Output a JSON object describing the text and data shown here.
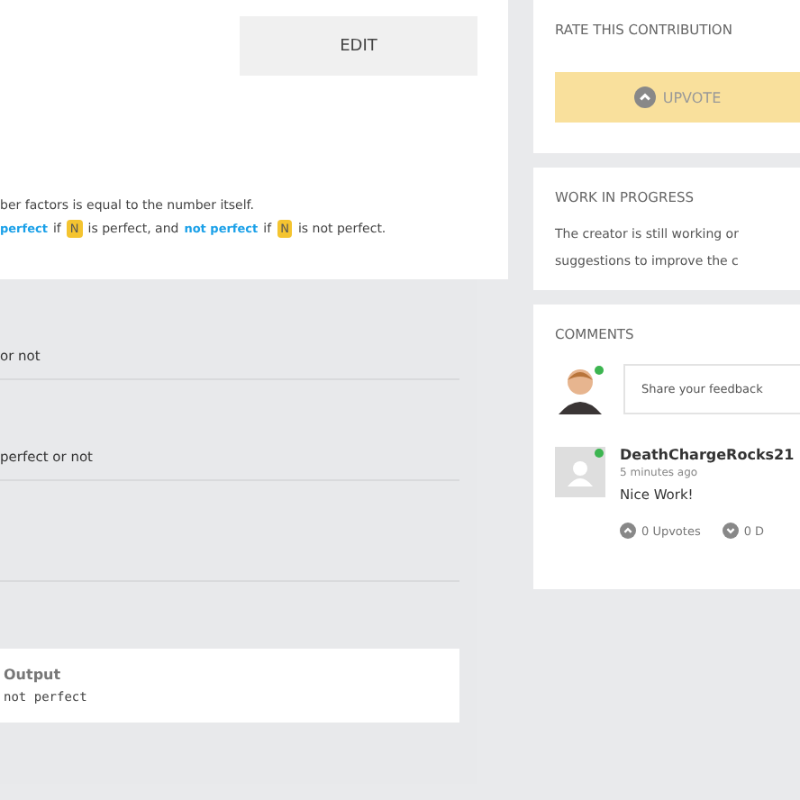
{
  "edit_button": "EDIT",
  "description": {
    "line_1": "ber factors is equal to the number itself.",
    "line_2": [
      {
        "kind": "code",
        "text": "perfect"
      },
      {
        "kind": "text",
        "text": "if"
      },
      {
        "kind": "var",
        "text": "N"
      },
      {
        "kind": "text",
        "text": "is perfect, and"
      },
      {
        "kind": "code",
        "text": "not perfect"
      },
      {
        "kind": "text",
        "text": "if"
      },
      {
        "kind": "var",
        "text": "N"
      },
      {
        "kind": "text",
        "text": "is not perfect."
      }
    ]
  },
  "rows": [
    "or not",
    "perfect or not",
    ""
  ],
  "output": {
    "title": "Output",
    "value": "not perfect"
  },
  "rate": {
    "title": "RATE THIS CONTRIBUTION",
    "button": "UPVOTE"
  },
  "work_in_progress": {
    "title": "WORK IN PROGRESS",
    "lines": [
      "The creator is still working or",
      "suggestions to improve the c"
    ]
  },
  "comments": {
    "title": "COMMENTS",
    "placeholder": "Share your feedback",
    "items": [
      {
        "author": "DeathChargeRocks21",
        "time": "5 minutes ago",
        "text": "Nice Work!",
        "online": true,
        "upvotes": "0 Upvotes",
        "downvotes": "0 D"
      }
    ]
  }
}
